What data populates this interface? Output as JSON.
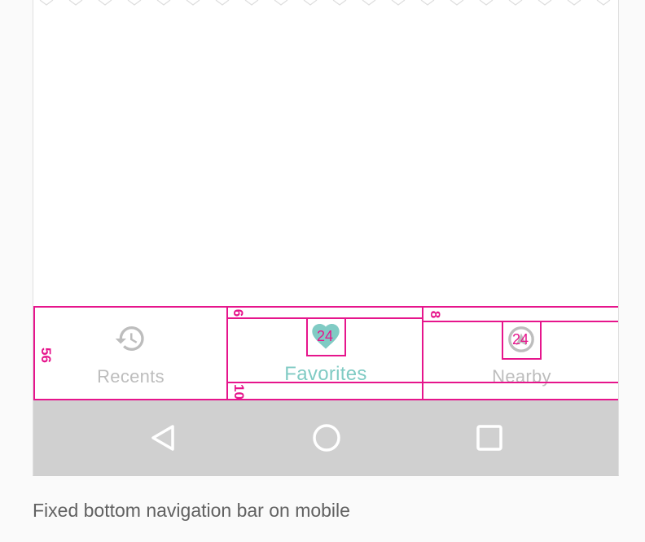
{
  "bottom_nav": {
    "items": [
      {
        "label": "Recents",
        "icon": "history-icon",
        "active": false
      },
      {
        "label": "Favorites",
        "icon": "heart-icon",
        "active": true
      },
      {
        "label": "Nearby",
        "icon": "location-icon",
        "active": false
      }
    ]
  },
  "specs": {
    "bar_height": "56",
    "top_padding_active": "6",
    "top_padding_inactive": "8",
    "bottom_padding": "10",
    "icon_size_active": "24",
    "icon_size_inactive": "24"
  },
  "system_nav": {
    "buttons": [
      "back-icon",
      "home-icon",
      "recents-apps-icon"
    ]
  },
  "caption": "Fixed bottom navigation bar on mobile",
  "colors": {
    "accent": "#80cbc4",
    "inactive": "#bdbdbd",
    "redline": "#e6158c",
    "system_bar": "#d0d0d0"
  }
}
